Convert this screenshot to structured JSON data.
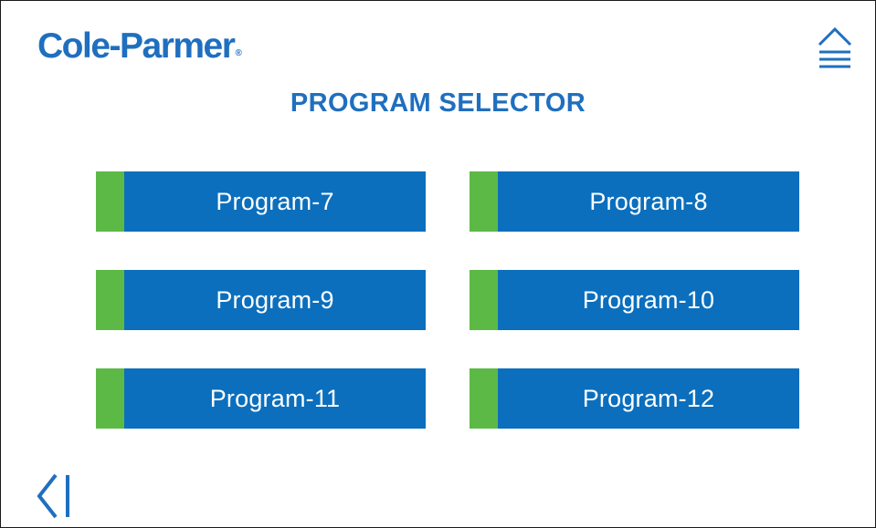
{
  "brand": {
    "name": "Cole-Parmer",
    "registered_mark": "®"
  },
  "page": {
    "title": "PROGRAM SELECTOR"
  },
  "header": {
    "menu_icon": "menu-eject-icon"
  },
  "programs": [
    {
      "label": "Program-7"
    },
    {
      "label": "Program-8"
    },
    {
      "label": "Program-9"
    },
    {
      "label": "Program-10"
    },
    {
      "label": "Program-11"
    },
    {
      "label": "Program-12"
    }
  ],
  "footer": {
    "back_icon": "back-chevron-icon"
  },
  "colors": {
    "brand_blue": "#1f6fbf",
    "button_blue": "#0b6fbd",
    "status_green": "#5cb946",
    "icon_blue": "#1f6fbf"
  }
}
